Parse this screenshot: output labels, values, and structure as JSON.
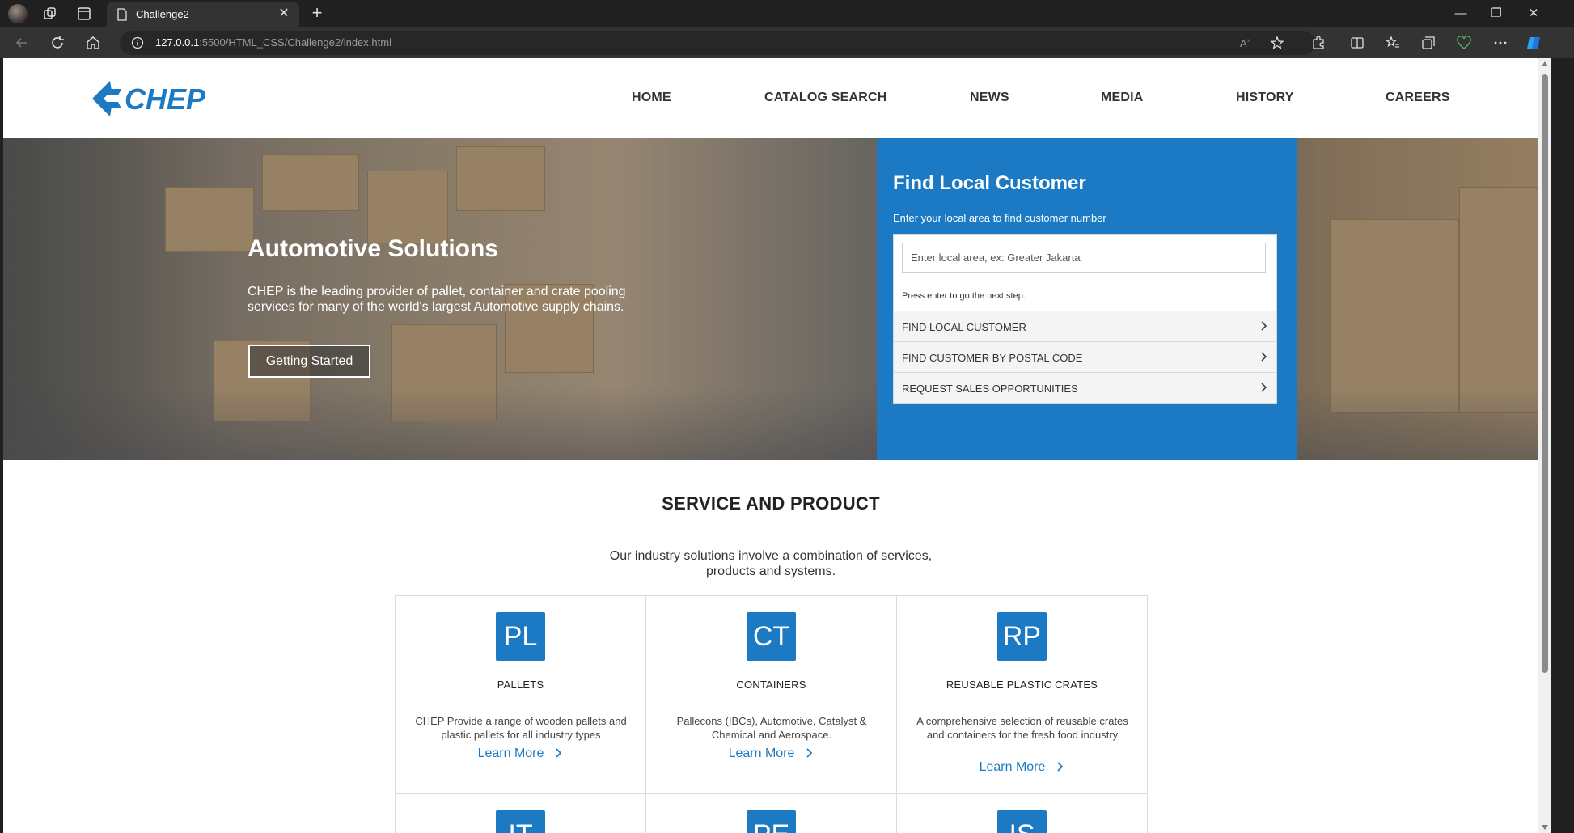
{
  "browser": {
    "tab_title": "Challenge2",
    "url_host": "127.0.0.1",
    "url_path": ":5500/HTML_CSS/Challenge2/index.html"
  },
  "site": {
    "logo_text": "CHEP",
    "nav": [
      "HOME",
      "CATALOG SEARCH",
      "NEWS",
      "MEDIA",
      "HISTORY",
      "CAREERS"
    ]
  },
  "hero": {
    "title": "Automotive Solutions",
    "text": "CHEP is the leading provider of pallet, container and crate pooling services for many of the world's largest Automotive supply chains.",
    "button": "Getting Started"
  },
  "find": {
    "title": "Find Local Customer",
    "subtitle": "Enter your local area to find customer number",
    "placeholder": "Enter local area, ex: Greater Jakarta",
    "hint": "Press enter to go the next step.",
    "options": [
      "FIND LOCAL CUSTOMER",
      "FIND CUSTOMER BY POSTAL CODE",
      "REQUEST SALES OPPORTUNITIES"
    ]
  },
  "services": {
    "title": "SERVICE AND PRODUCT",
    "subtitle": "Our industry solutions involve a combination of services, products and systems.",
    "cards": [
      {
        "code": "PL",
        "title": "PALLETS",
        "desc": "CHEP Provide a range of wooden pallets and plastic pallets for all industry types",
        "link": "Learn More"
      },
      {
        "code": "CT",
        "title": "CONTAINERS",
        "desc": "Pallecons (IBCs), Automotive, Catalyst & Chemical and Aerospace.",
        "link": "Learn More"
      },
      {
        "code": "RP",
        "title": "REUSABLE PLASTIC CRATES",
        "desc": "A comprehensive selection of reusable crates and containers for the fresh food industry",
        "link": "Learn More"
      },
      {
        "code": "IT"
      },
      {
        "code": "PE"
      },
      {
        "code": "IS"
      }
    ]
  },
  "colors": {
    "brand_blue": "#1b7ac3",
    "chrome_dark": "#202020"
  }
}
